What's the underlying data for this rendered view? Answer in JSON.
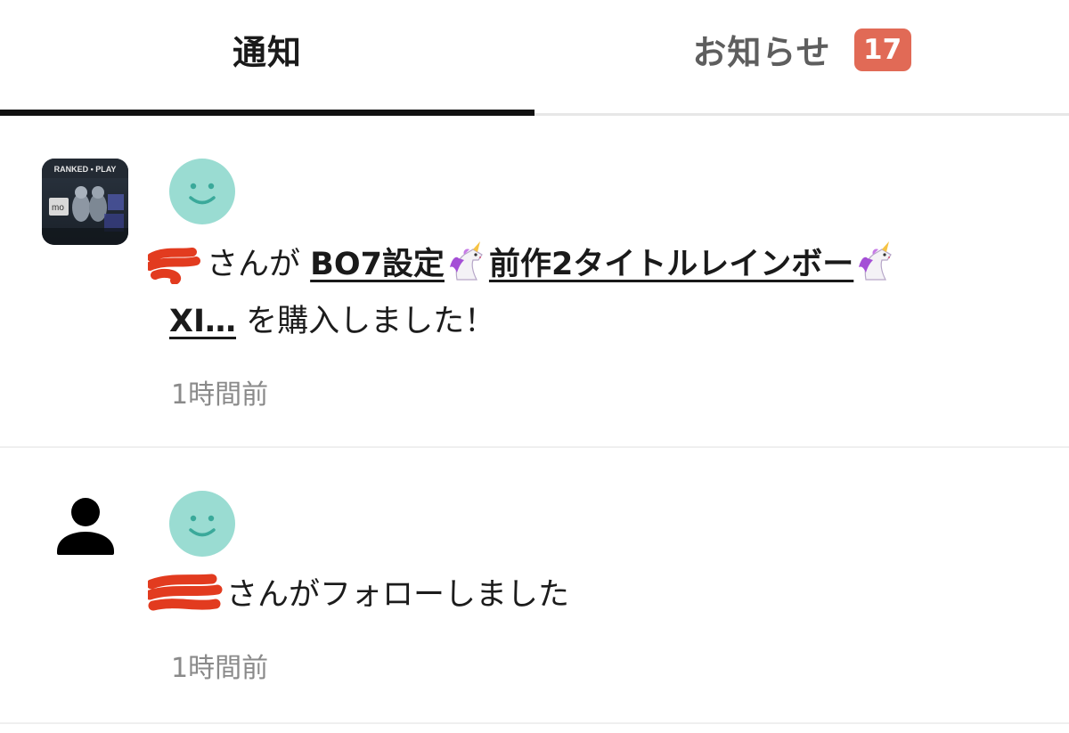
{
  "tabs": {
    "notifications_label": "通知",
    "news_label": "お知らせ",
    "news_badge": "17"
  },
  "colors": {
    "badge": "#e16a56",
    "smiley": "#9adcd2",
    "redaction": "#e23b1f",
    "active_tab_underline": "#111111"
  },
  "items": [
    {
      "avatar_icon": "smiley-avatar-icon",
      "thumbnail": "ranked-play-thumbnail",
      "thumbnail_text": "RANKED • PLAY",
      "user_suffix": "さんが ",
      "link_part1": "BO7設定",
      "link_part2": "前作2タイトルレインボー",
      "link_part3": "XI…",
      "emoji": "unicorn-icon",
      "message_suffix": " を購入しました！",
      "time": "1時間前"
    },
    {
      "avatar_icon": "smiley-avatar-icon",
      "user_icon": "person-icon",
      "message": "さんがフォローしました",
      "time": "1時間前"
    }
  ]
}
